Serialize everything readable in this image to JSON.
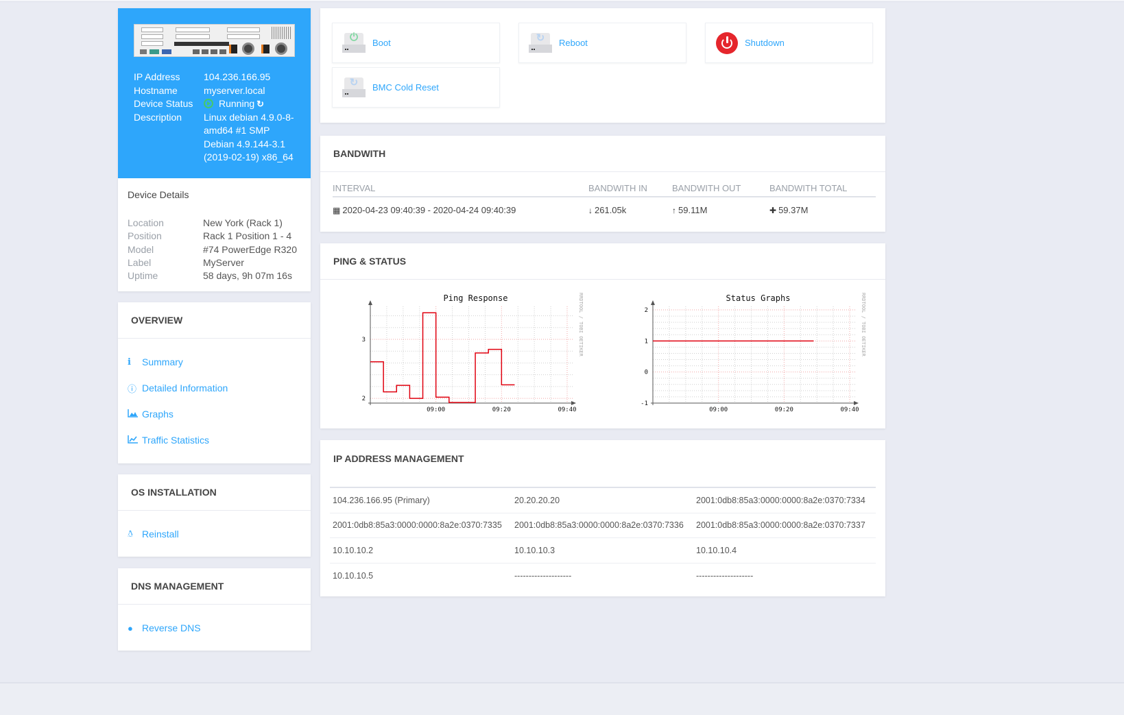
{
  "server": {
    "info": [
      {
        "label": "IP Address",
        "value": "104.236.166.95"
      },
      {
        "label": "Hostname",
        "value": "myserver.local"
      },
      {
        "label": "Device Status",
        "value": "Running"
      },
      {
        "label": "Description",
        "value": "Linux debian 4.9.0-8-amd64 #1 SMP Debian 4.9.144-3.1 (2019-02-19) x86_64"
      }
    ],
    "status_color": "#45c96b"
  },
  "device_details": {
    "title": "Device Details",
    "rows": [
      {
        "label": "Location",
        "value": "New York (Rack 1)"
      },
      {
        "label": "Position",
        "value": "Rack 1 Position 1 - 4"
      },
      {
        "label": "Model",
        "value": "#74 PowerEdge R320"
      },
      {
        "label": "Label",
        "value": "MyServer"
      },
      {
        "label": "Uptime",
        "value": "58 days, 9h 07m 16s"
      }
    ]
  },
  "overview": {
    "title": "OVERVIEW",
    "items": [
      {
        "label": "Summary",
        "icon": "info-icon"
      },
      {
        "label": "Detailed Information",
        "icon": "info-circle-icon"
      },
      {
        "label": "Graphs",
        "icon": "area-chart-icon"
      },
      {
        "label": "Traffic Statistics",
        "icon": "line-chart-icon"
      }
    ]
  },
  "os_installation": {
    "title": "OS INSTALLATION",
    "items": [
      {
        "label": "Reinstall",
        "icon": "linux-icon"
      }
    ]
  },
  "dns_management": {
    "title": "DNS MANAGEMENT",
    "items": [
      {
        "label": "Reverse DNS",
        "icon": "globe-icon"
      }
    ]
  },
  "power": {
    "boot": "Boot",
    "reboot": "Reboot",
    "shutdown": "Shutdown",
    "bmc_reset": "BMC Cold Reset"
  },
  "bandwidth": {
    "title": "BANDWITH",
    "headers": [
      "INTERVAL",
      "BANDWITH IN",
      "BANDWITH OUT",
      "BANDWITH TOTAL"
    ],
    "row": {
      "interval": "2020-04-23 09:40:39 - 2020-04-24 09:40:39",
      "in": "261.05k",
      "out": "59.11M",
      "total": "59.37M"
    }
  },
  "ping_status": {
    "title": "PING & STATUS",
    "watermark": "RRDTOOL / TOBI OETIKER"
  },
  "chart_data": [
    {
      "type": "line",
      "title": "Ping Response",
      "x_ticks": [
        "09:00",
        "09:20",
        "09:40"
      ],
      "y_ticks": [
        2,
        3
      ],
      "ylim": [
        1.92,
        3.5
      ],
      "x_range_minutes": [
        -20,
        40
      ],
      "series": [
        {
          "name": "ping",
          "color": "#e0000f",
          "step": true,
          "x": [
            -20,
            -16,
            -12,
            -8,
            -4,
            0,
            4,
            8,
            12,
            16,
            20,
            24,
            28,
            32
          ],
          "values": [
            2.62,
            2.11,
            2.22,
            2.0,
            3.45,
            2.02,
            1.93,
            1.93,
            2.77,
            2.83,
            2.23,
            null,
            null,
            null
          ]
        }
      ],
      "grid": true
    },
    {
      "type": "line",
      "title": "Status Graphs",
      "x_ticks": [
        "09:00",
        "09:20",
        "09:40"
      ],
      "y_ticks": [
        -1,
        0,
        1,
        2
      ],
      "ylim": [
        -1,
        2
      ],
      "x_range_minutes": [
        -20,
        40
      ],
      "series": [
        {
          "name": "status",
          "color": "#e0000f",
          "step": true,
          "x": [
            -20,
            29
          ],
          "values": [
            1,
            1
          ]
        }
      ],
      "grid": true
    }
  ],
  "ip_management": {
    "title": "IP ADDRESS MANAGEMENT",
    "rows": [
      [
        "104.236.166.95 (Primary)",
        "20.20.20.20",
        "2001:0db8:85a3:0000:0000:8a2e:0370:7334"
      ],
      [
        "2001:0db8:85a3:0000:0000:8a2e:0370:7335",
        "2001:0db8:85a3:0000:0000:8a2e:0370:7336",
        "2001:0db8:85a3:0000:0000:8a2e:0370:7337"
      ],
      [
        "10.10.10.2",
        "10.10.10.3",
        "10.10.10.4"
      ],
      [
        "10.10.10.5",
        "--------------------",
        "--------------------"
      ]
    ]
  }
}
